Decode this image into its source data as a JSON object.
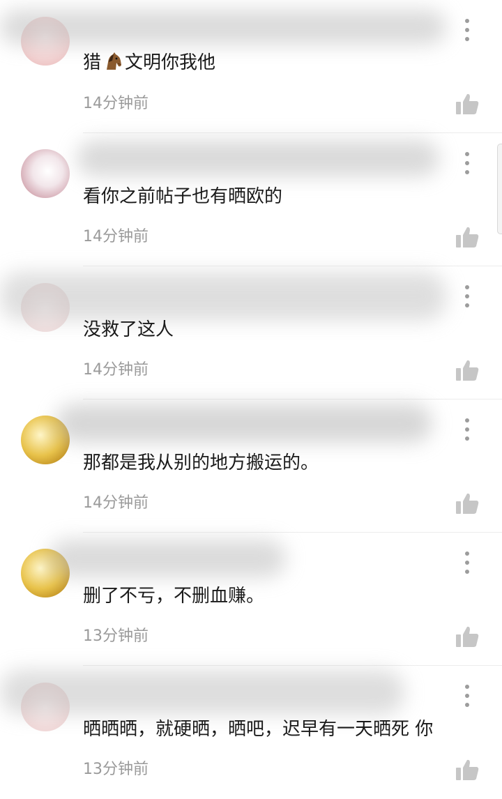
{
  "comments": [
    {
      "text_before": "猎",
      "emoji": "horse-face",
      "text_after": "文明你我他",
      "time": "14分钟前"
    },
    {
      "text": "看你之前帖子也有晒欧的",
      "time": "14分钟前"
    },
    {
      "text": "没救了这人",
      "time": "14分钟前"
    },
    {
      "text": "那都是我从别的地方搬运的。",
      "time": "14分钟前"
    },
    {
      "text": "删了不亏，不删血赚。",
      "time": "13分钟前"
    },
    {
      "text": "晒晒晒，就硬晒，晒吧，迟早有一天晒死 你",
      "time": "13分钟前"
    }
  ],
  "colors": {
    "text": "#1a1a1a",
    "timestamp": "#9a9a9a",
    "icon": "#9c9c9c",
    "separator": "#ececec"
  }
}
